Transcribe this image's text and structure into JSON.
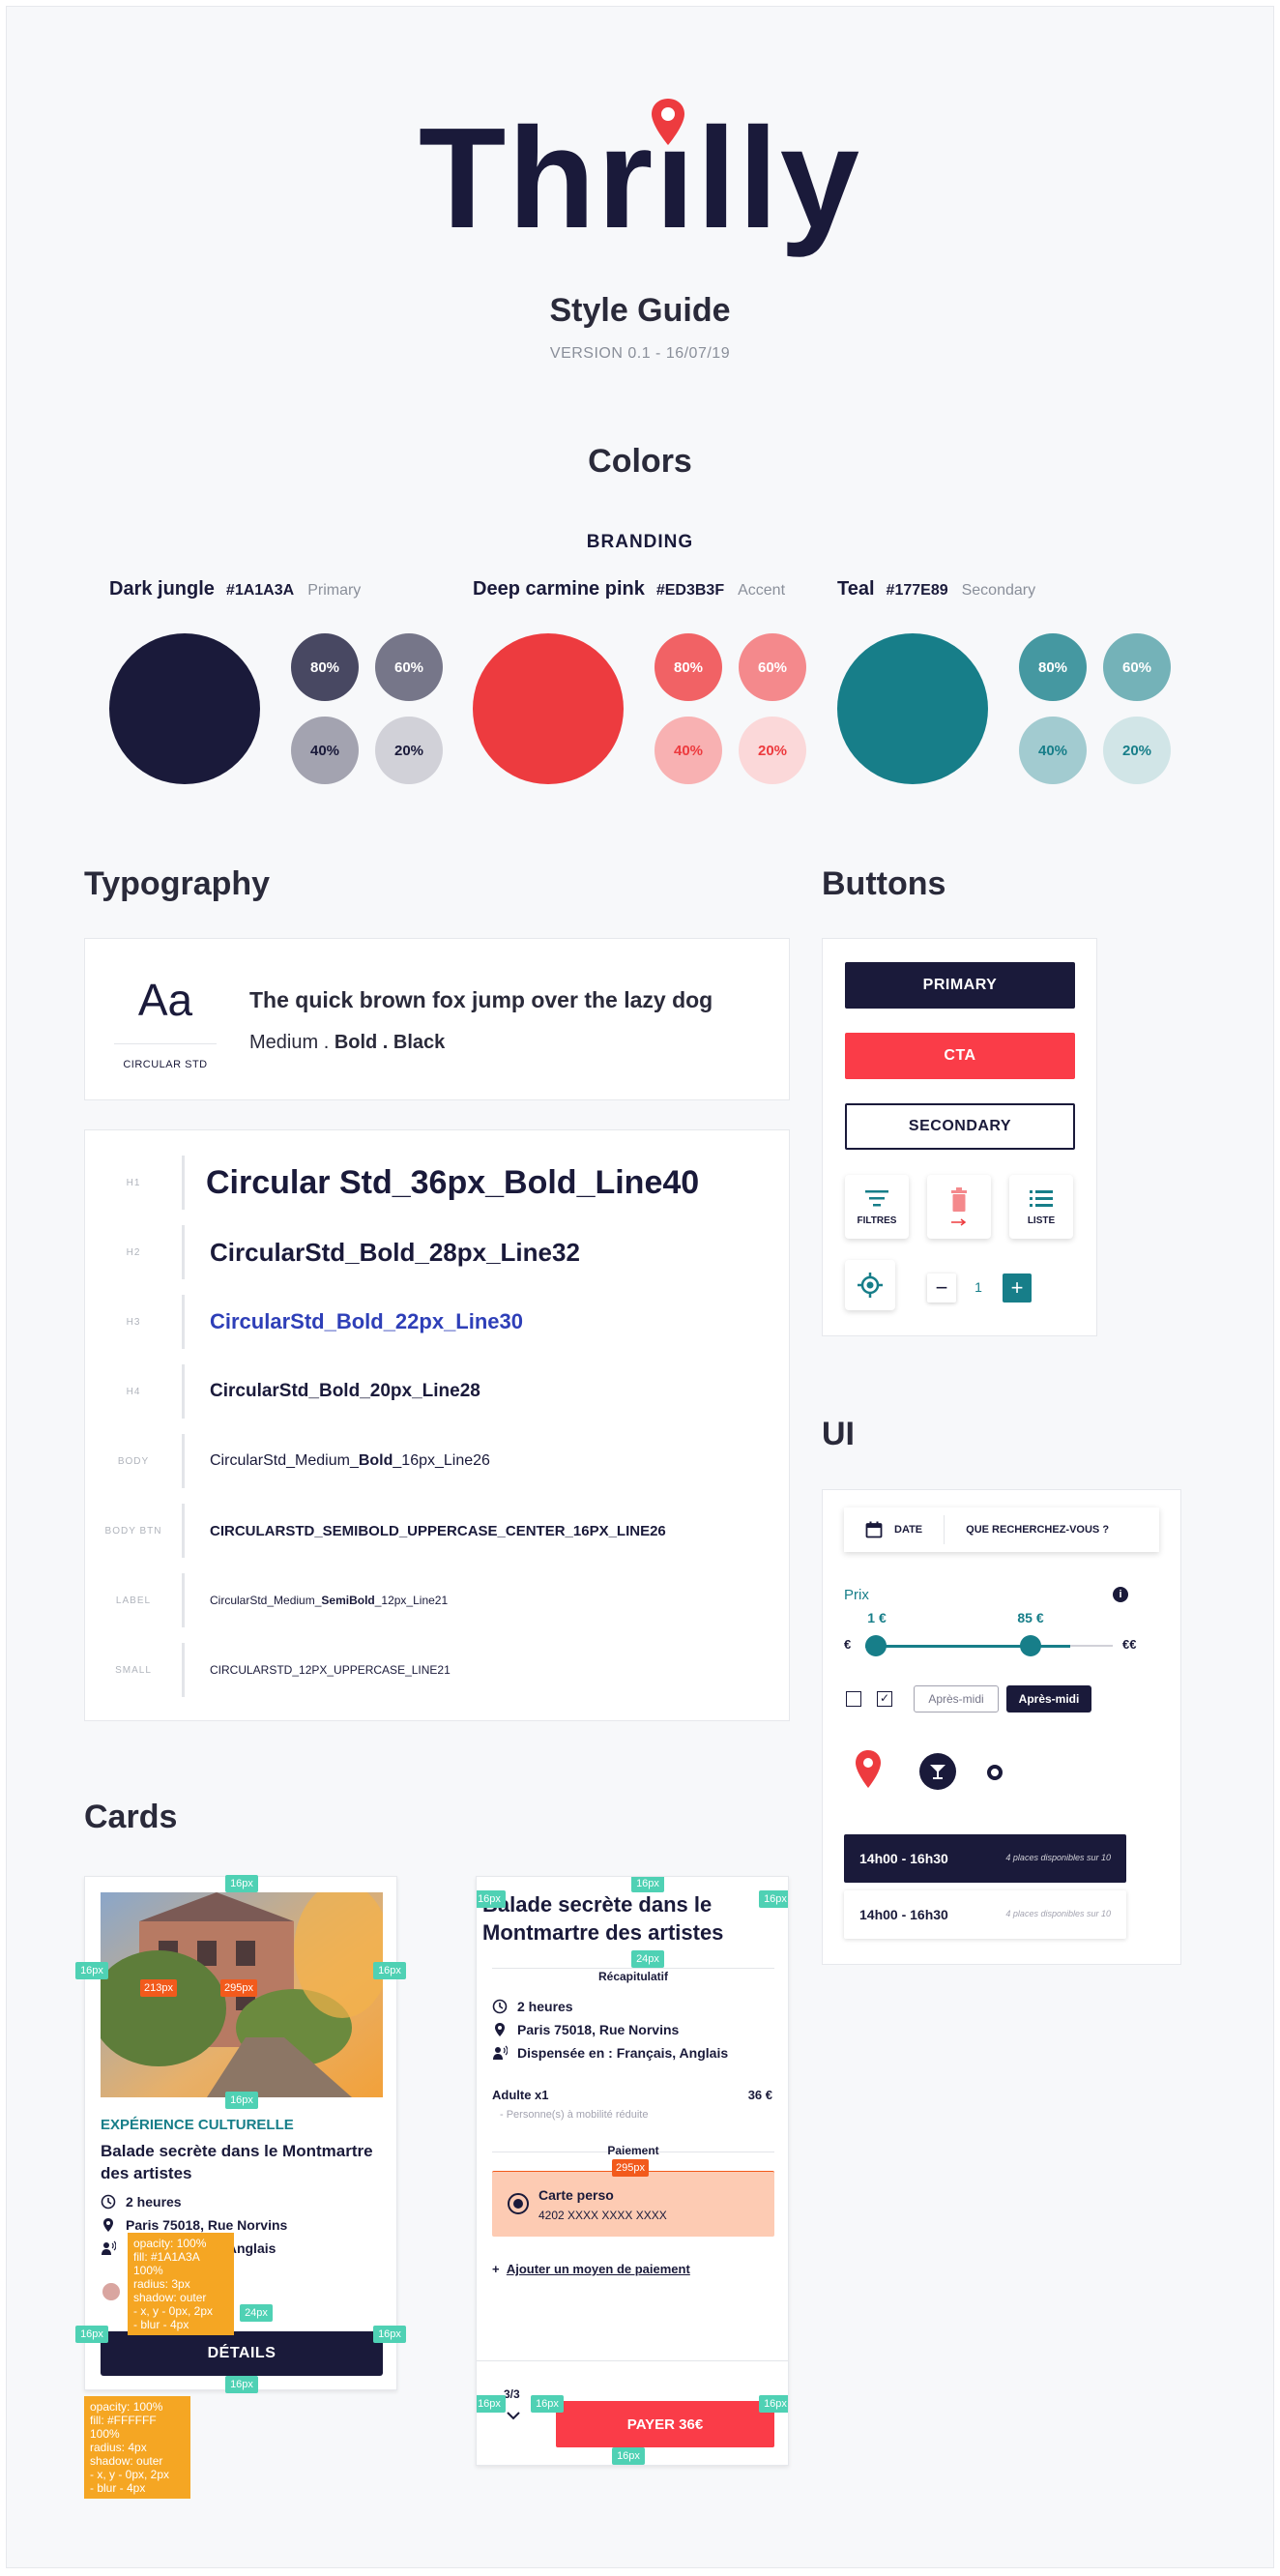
{
  "header": {
    "logo_left": "Thr",
    "logo_i": "ı",
    "logo_right": "lly",
    "title": "Style Guide",
    "version": "VERSION 0.1 - 16/07/19"
  },
  "colors": {
    "title": "Colors",
    "branding": "BRANDING",
    "groups": [
      {
        "name": "Dark jungle",
        "hex": "#1A1A3A",
        "role": "Primary",
        "shades": [
          {
            "label": "80%",
            "bg": "#484862",
            "fg": "#ffffff"
          },
          {
            "label": "60%",
            "bg": "#767689",
            "fg": "#ffffff"
          },
          {
            "label": "40%",
            "bg": "#A3A3B0",
            "fg": "#1A1A3A"
          },
          {
            "label": "20%",
            "bg": "#D1D1D8",
            "fg": "#1A1A3A"
          }
        ]
      },
      {
        "name": "Deep carmine pink",
        "hex": "#ED3B3F",
        "role": "Accent",
        "shades": [
          {
            "label": "80%",
            "bg": "#F16265",
            "fg": "#ffffff"
          },
          {
            "label": "60%",
            "bg": "#F4898C",
            "fg": "#ffffff"
          },
          {
            "label": "40%",
            "bg": "#F8B1B2",
            "fg": "#ED3B3F"
          },
          {
            "label": "20%",
            "bg": "#FBD8D9",
            "fg": "#ED3B3F"
          }
        ]
      },
      {
        "name": "Teal",
        "hex": "#177E89",
        "role": "Secondary",
        "shades": [
          {
            "label": "80%",
            "bg": "#4598A1",
            "fg": "#ffffff"
          },
          {
            "label": "60%",
            "bg": "#74B2B8",
            "fg": "#ffffff"
          },
          {
            "label": "40%",
            "bg": "#A2CBD0",
            "fg": "#177E89"
          },
          {
            "label": "20%",
            "bg": "#D1E5E7",
            "fg": "#177E89"
          }
        ]
      }
    ]
  },
  "typography": {
    "title": "Typography",
    "sample_glyph": "Aa",
    "font_name": "CIRCULAR STD",
    "pangram": "The quick brown fox jump over the lazy dog",
    "weights_medium": "Medium . ",
    "weights_bold": "Bold . ",
    "weights_black": "Black",
    "rows": [
      {
        "tag": "H1",
        "text": "Circular Std_36px_Bold_Line40"
      },
      {
        "tag": "H2",
        "text": "CircularStd_Bold_28px_Line32"
      },
      {
        "tag": "H3",
        "text": "CircularStd_Bold_22px_Line30"
      },
      {
        "tag": "H4",
        "text": "CircularStd_Bold_20px_Line28"
      },
      {
        "tag": "BODY",
        "text_a": "CircularStd_Medium_",
        "text_b": "Bold",
        "text_c": "_16px_Line26"
      },
      {
        "tag": "BODY BTN",
        "text": "CIRCULARSTD_SEMIBOLD_UPPERCASE_CENTER_16PX_LINE26"
      },
      {
        "tag": "LABEL",
        "text_a": "CircularStd_Medium_",
        "text_b": "SemiBold",
        "text_c": "_12px_Line21"
      },
      {
        "tag": "SMALL",
        "text": "CIRCULARSTD_12PX_UPPERCASE_LINE21"
      }
    ]
  },
  "buttons": {
    "title": "Buttons",
    "primary": "PRIMARY",
    "cta": "CTA",
    "secondary": "SECONDARY",
    "filters": "FILTRES",
    "list": "LISTE",
    "stepper_value": "1"
  },
  "ui": {
    "title": "UI",
    "date": "DATE",
    "search": "QUE RECHERCHEZ-VOUS ?",
    "price_label": "Prix",
    "min_price": "1 €",
    "max_price": "85 €",
    "min_symbol": "€",
    "max_symbol": "€€",
    "pill_outline": "Après-midi",
    "pill_filled": "Après-midi",
    "slots": [
      {
        "time": "14h00 - 16h30",
        "info": "4 places disponibles sur 10"
      },
      {
        "time": "14h00 - 16h30",
        "info": "4 places disponibles sur 10"
      }
    ]
  },
  "cards": {
    "title": "Cards",
    "card1": {
      "category": "EXPÉRIENCE CULTURELLE",
      "title": "Balade secrète dans le Montmartre des artistes",
      "duration": "2 heures",
      "address": "Paris 75018, Rue Norvins",
      "languages": "Français, Anglais",
      "button": "DÉTAILS"
    },
    "card2": {
      "title": "Balade secrète dans le Montmartre des artistes",
      "recap": "Récapitulatif",
      "duration": "2 heures",
      "address": "Paris 75018, Rue Norvins",
      "languages": "Dispensée en : Français, Anglais",
      "adult": "Adulte x1",
      "adult_price": "36 €",
      "reduced": "- Personne(s) à mobilité réduite",
      "payment": "Paiement",
      "card_name": "Carte perso",
      "card_number": "4202 XXXX XXXX XXXX",
      "add_payment": "Ajouter un moyen de paiement",
      "add_plus": "+",
      "step": "3/3",
      "pay": "PAYER 36€"
    },
    "spec_16": "16px",
    "spec_24": "24px",
    "spec_213": "213px",
    "spec_295": "295px",
    "note1": [
      "opacity: 100%",
      "fill: #1A1A3A 100%",
      "radius: 3px",
      "shadow: outer",
      " - x, y - 0px, 2px",
      " - blur - 4px"
    ],
    "note2": [
      "opacity: 100%",
      "fill: #FFFFFF 100%",
      "radius: 4px",
      "shadow: outer",
      " - x, y - 0px, 2px",
      " - blur - 4px"
    ]
  }
}
